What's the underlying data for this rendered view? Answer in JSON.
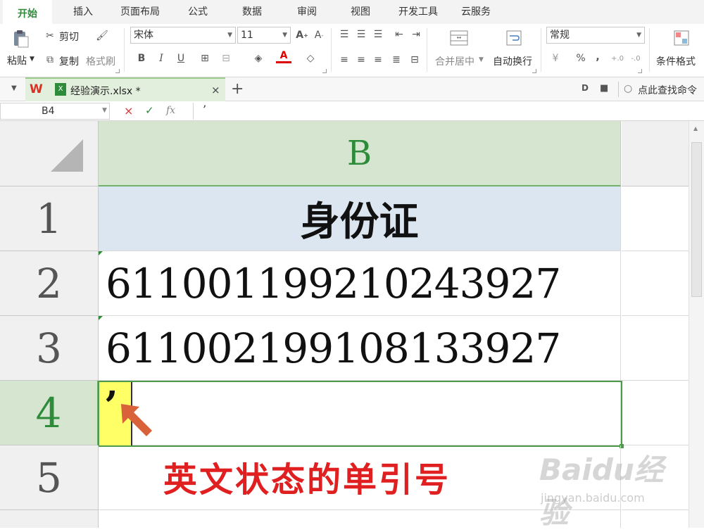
{
  "menu": {
    "tabs": [
      "开始",
      "插入",
      "页面布局",
      "公式",
      "数据",
      "审阅",
      "视图",
      "开发工具",
      "云服务"
    ]
  },
  "ribbon": {
    "paste": "粘贴",
    "cut": "剪切",
    "copy": "复制",
    "format_painter": "格式刷",
    "font_name": "宋体",
    "font_size": "11",
    "bold": "B",
    "italic": "I",
    "underline": "U",
    "merge_center": "合并居中",
    "wrap_text": "自动换行",
    "number_format": "常规",
    "percent": "%",
    "comma": ",",
    "conditional_format": "条件格式"
  },
  "docbar": {
    "filename": "经验演示.xlsx *",
    "search_cmd": "点此查找命令"
  },
  "formula_bar": {
    "cell_ref": "B4",
    "fx": "fx",
    "content": "’"
  },
  "sheet": {
    "column_header": "B",
    "rows": [
      {
        "num": "1",
        "value": "身份证"
      },
      {
        "num": "2",
        "value": "611001199210243927"
      },
      {
        "num": "3",
        "value": "611002199108133927"
      },
      {
        "num": "4",
        "value": "’"
      },
      {
        "num": "5",
        "value": ""
      }
    ],
    "annotation": "英文状态的单引号"
  },
  "watermark": {
    "logo": "Baidu经验",
    "url": "jingyan.baidu.com"
  },
  "colors": {
    "accent_green": "#2e8b3a",
    "header_blue": "#dce6f0",
    "highlight_yellow": "#ffff66",
    "annotation_red": "#e02020",
    "arrow_orange": "#d9623b"
  }
}
